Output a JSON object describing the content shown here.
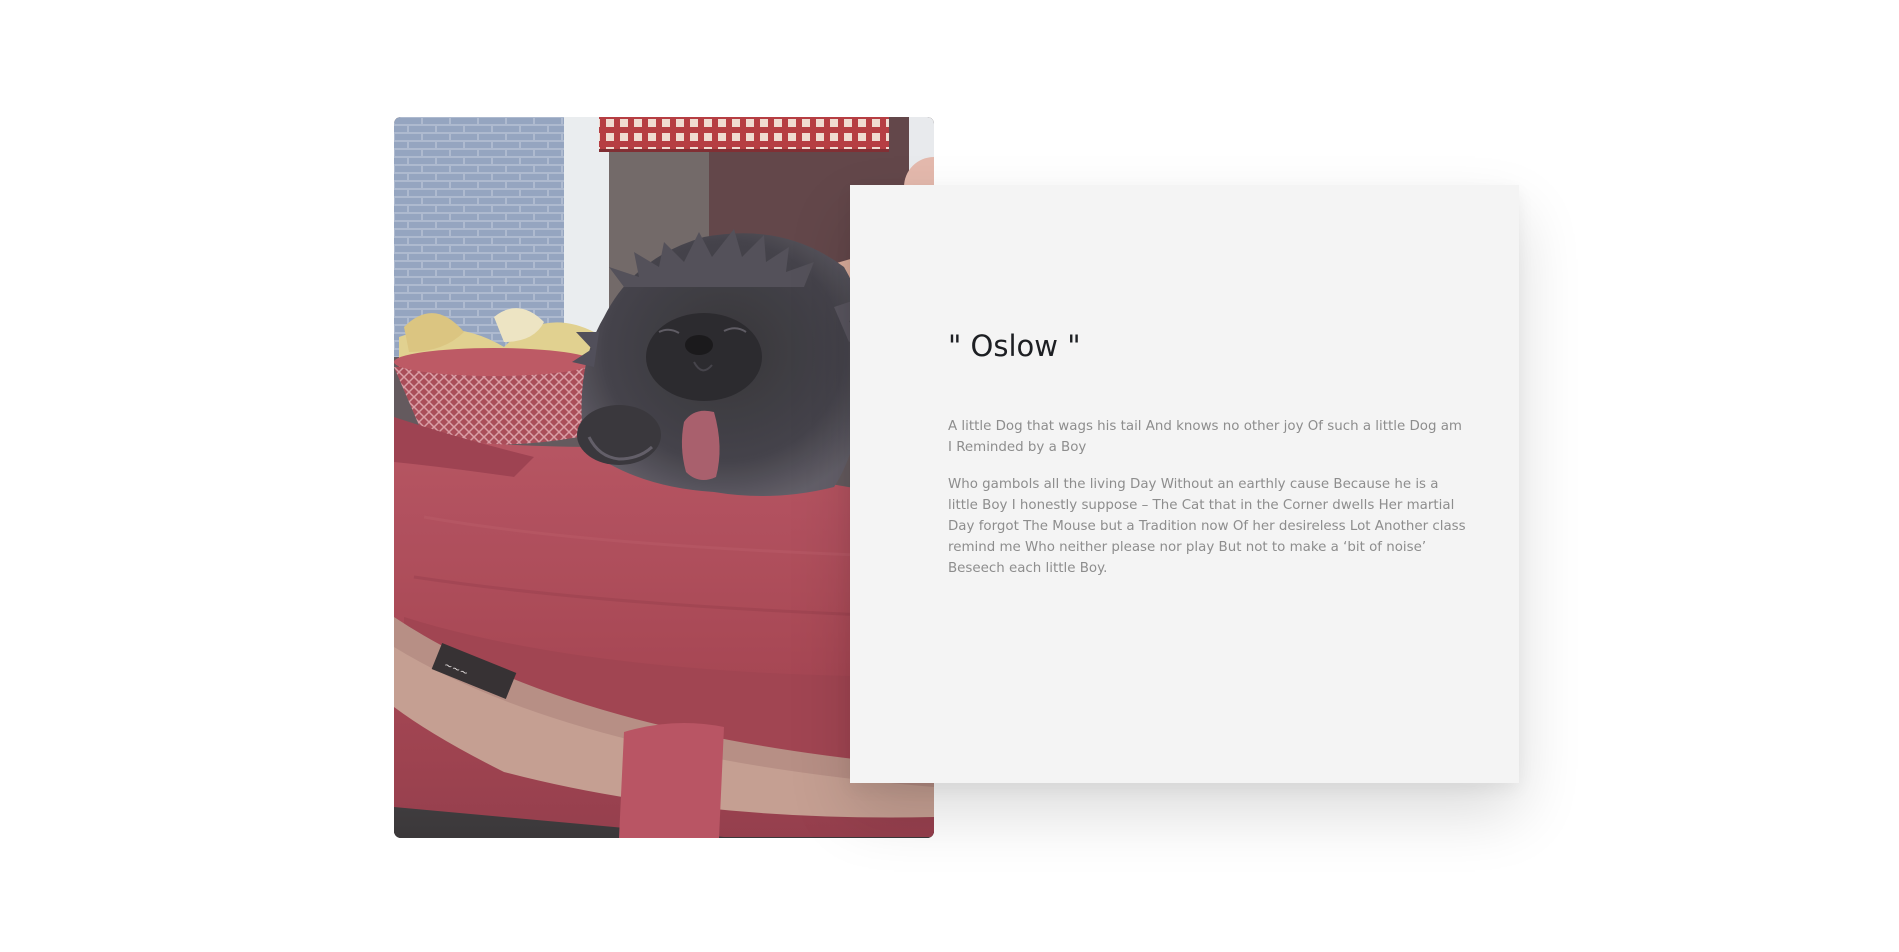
{
  "profile": {
    "title": "\" Oslow \"",
    "paragraphs": [
      "A little Dog that wags his tail And knows no other joy Of such a little Dog am I Reminded by a Boy",
      "Who gambols all the living Day Without an earthly cause Because he is a little Boy I honestly suppose – The Cat that in the Corner dwells Her martial Day forgot The Mouse but a Tradition now Of her desireless Lot Another class remind me Who neither please nor play But not to make a ‘bit of noise’ Beseech each little Boy."
    ]
  },
  "colors": {
    "page_background": "#ffffff",
    "card_background": "#f4f4f4",
    "title_color": "#1d1f23",
    "body_text_color": "#8d8d8d",
    "cushion_red": "#a83f4d"
  }
}
